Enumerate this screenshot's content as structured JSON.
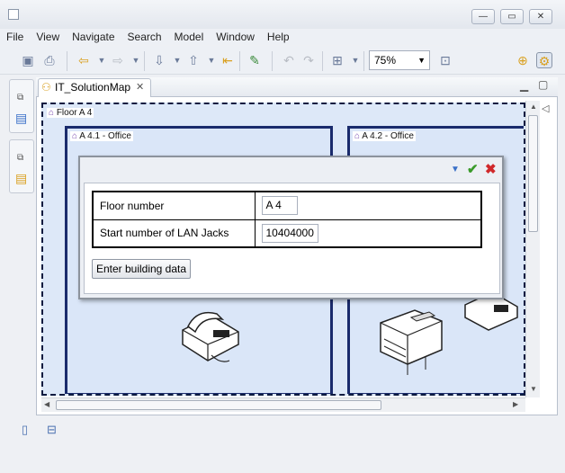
{
  "window": {
    "minimize_glyph": "—",
    "maximize_glyph": "▭",
    "close_glyph": "✕"
  },
  "menu": [
    "File",
    "View",
    "Navigate",
    "Search",
    "Model",
    "Window",
    "Help"
  ],
  "toolbar": {
    "zoom": "75%"
  },
  "editor": {
    "tab_title": "IT_SolutionMap",
    "floor_label": "Floor A 4",
    "office1_label": "A 4.1 - Office",
    "office2_label": "A 4.2 - Office"
  },
  "dialog": {
    "rows": [
      {
        "label": "Floor number",
        "value": "A 4"
      },
      {
        "label": "Start number of LAN Jacks",
        "value": "10404000"
      }
    ],
    "button_label": "Enter building data"
  },
  "colors": {
    "office_border": "#1a2b6c",
    "canvas_bg": "#dde8f8",
    "confirm": "#3a9a2a",
    "cancel": "#d0282a"
  }
}
